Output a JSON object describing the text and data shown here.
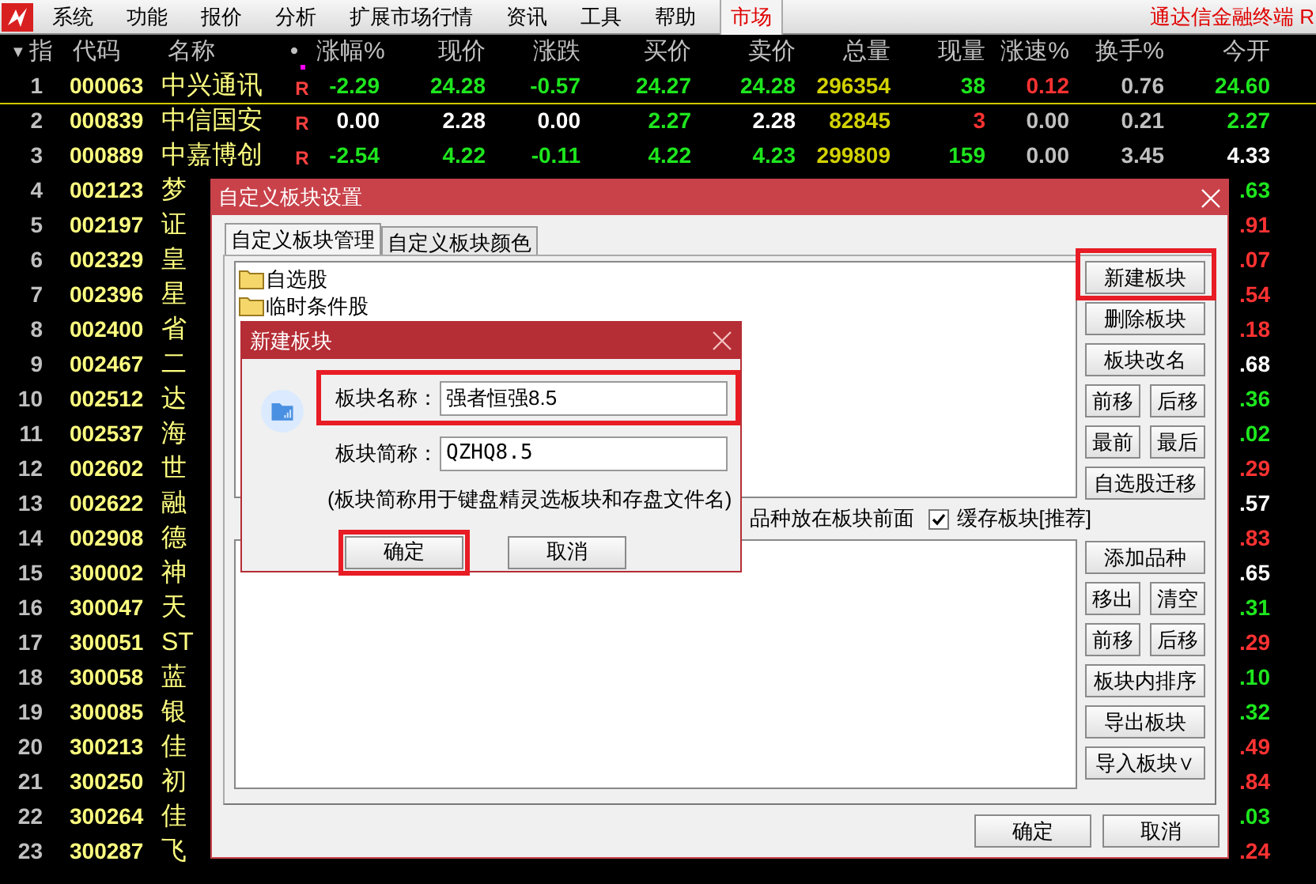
{
  "menu_bar": {
    "items": [
      "系统",
      "功能",
      "报价",
      "分析",
      "扩展市场行情",
      "资讯",
      "工具",
      "帮助"
    ],
    "tab": {
      "label": "市场",
      "selected": true
    },
    "brand": "通达信金融终端 R"
  },
  "table": {
    "sort_glyph": "▼",
    "lead_columns": [
      "指",
      "代码",
      "名称",
      "•"
    ],
    "columns": [
      "涨幅%",
      "现价",
      "涨跌",
      "买价",
      "卖价",
      "总量",
      "现量",
      "涨速%",
      "换手%",
      "今开"
    ],
    "rows": [
      {
        "kind": "full",
        "index": "1",
        "code": "000063",
        "name": "中兴通讯",
        "tag": "R",
        "flagged": true,
        "selected": true,
        "cells": [
          {
            "text": "-2.29",
            "color": "#1ee61e"
          },
          {
            "text": "24.28",
            "color": "#1ee61e"
          },
          {
            "text": "-0.57",
            "color": "#1ee61e"
          },
          {
            "text": "24.27",
            "color": "#1ee61e"
          },
          {
            "text": "24.28",
            "color": "#1ee61e"
          },
          {
            "text": "296354",
            "color": "#d2d200"
          },
          {
            "text": "38",
            "color": "#1ee61e"
          },
          {
            "text": "0.12",
            "color": "#ff3232"
          },
          {
            "text": "0.76",
            "color": "#c0c0c0"
          },
          {
            "text": "24.60",
            "color": "#1ee61e"
          }
        ]
      },
      {
        "kind": "full",
        "index": "2",
        "code": "000839",
        "name": "中信国安",
        "tag": "R",
        "flagged": false,
        "selected": false,
        "cells": [
          {
            "text": "0.00",
            "color": "#ffffff"
          },
          {
            "text": "2.28",
            "color": "#ffffff"
          },
          {
            "text": "0.00",
            "color": "#ffffff"
          },
          {
            "text": "2.27",
            "color": "#1ee61e"
          },
          {
            "text": "2.28",
            "color": "#ffffff"
          },
          {
            "text": "82845",
            "color": "#d2d200"
          },
          {
            "text": "3",
            "color": "#ff3232"
          },
          {
            "text": "0.00",
            "color": "#c0c0c0"
          },
          {
            "text": "0.21",
            "color": "#c0c0c0"
          },
          {
            "text": "2.27",
            "color": "#1ee61e"
          }
        ]
      },
      {
        "kind": "full",
        "index": "3",
        "code": "000889",
        "name": "中嘉博创",
        "tag": "R",
        "flagged": false,
        "selected": false,
        "cells": [
          {
            "text": "-2.54",
            "color": "#1ee61e"
          },
          {
            "text": "4.22",
            "color": "#1ee61e"
          },
          {
            "text": "-0.11",
            "color": "#1ee61e"
          },
          {
            "text": "4.22",
            "color": "#1ee61e"
          },
          {
            "text": "4.23",
            "color": "#1ee61e"
          },
          {
            "text": "299809",
            "color": "#d2d200"
          },
          {
            "text": "159",
            "color": "#1ee61e"
          },
          {
            "text": "0.00",
            "color": "#c0c0c0"
          },
          {
            "text": "3.45",
            "color": "#c0c0c0"
          },
          {
            "text": "4.33",
            "color": "#ffffff"
          }
        ]
      },
      {
        "kind": "covered",
        "index": "4",
        "code": "002123",
        "name": "梦",
        "selected": false,
        "cells": [
          {
            "text": ".63",
            "color": "#1ee61e"
          }
        ]
      },
      {
        "kind": "covered",
        "index": "5",
        "code": "002197",
        "name": "证",
        "selected": false,
        "cells": [
          {
            "text": ".91",
            "color": "#ff3232"
          }
        ]
      },
      {
        "kind": "covered",
        "index": "6",
        "code": "002329",
        "name": "皇",
        "selected": false,
        "cells": [
          {
            "text": ".07",
            "color": "#ff3232"
          }
        ]
      },
      {
        "kind": "covered",
        "index": "7",
        "code": "002396",
        "name": "星",
        "selected": false,
        "cells": [
          {
            "text": ".54",
            "color": "#ff3232"
          }
        ]
      },
      {
        "kind": "covered",
        "index": "8",
        "code": "002400",
        "name": "省",
        "selected": false,
        "cells": [
          {
            "text": ".18",
            "color": "#ff3232"
          }
        ]
      },
      {
        "kind": "covered",
        "index": "9",
        "code": "002467",
        "name": "二",
        "selected": false,
        "cells": [
          {
            "text": ".68",
            "color": "#ffffff"
          }
        ]
      },
      {
        "kind": "covered",
        "index": "10",
        "code": "002512",
        "name": "达",
        "selected": false,
        "cells": [
          {
            "text": ".36",
            "color": "#1ee61e"
          }
        ]
      },
      {
        "kind": "covered",
        "index": "11",
        "code": "002537",
        "name": "海",
        "selected": false,
        "cells": [
          {
            "text": ".02",
            "color": "#1ee61e"
          }
        ]
      },
      {
        "kind": "covered",
        "index": "12",
        "code": "002602",
        "name": "世",
        "selected": false,
        "cells": [
          {
            "text": ".29",
            "color": "#ff3232"
          }
        ]
      },
      {
        "kind": "covered",
        "index": "13",
        "code": "002622",
        "name": "融",
        "selected": false,
        "cells": [
          {
            "text": ".57",
            "color": "#ffffff"
          }
        ]
      },
      {
        "kind": "covered",
        "index": "14",
        "code": "002908",
        "name": "德",
        "selected": false,
        "cells": [
          {
            "text": ".83",
            "color": "#ff3232"
          }
        ]
      },
      {
        "kind": "covered",
        "index": "15",
        "code": "300002",
        "name": "神",
        "selected": false,
        "cells": [
          {
            "text": ".65",
            "color": "#ffffff"
          }
        ]
      },
      {
        "kind": "covered",
        "index": "16",
        "code": "300047",
        "name": "天",
        "selected": false,
        "cells": [
          {
            "text": ".31",
            "color": "#1ee61e"
          }
        ]
      },
      {
        "kind": "covered",
        "index": "17",
        "code": "300051",
        "name": "ST",
        "selected": false,
        "cells": [
          {
            "text": ".29",
            "color": "#ff3232"
          }
        ]
      },
      {
        "kind": "covered",
        "index": "18",
        "code": "300058",
        "name": "蓝",
        "selected": false,
        "cells": [
          {
            "text": ".10",
            "color": "#1ee61e"
          }
        ]
      },
      {
        "kind": "covered",
        "index": "19",
        "code": "300085",
        "name": "银",
        "selected": false,
        "cells": [
          {
            "text": ".32",
            "color": "#1ee61e"
          }
        ]
      },
      {
        "kind": "covered",
        "index": "20",
        "code": "300213",
        "name": "佳",
        "selected": false,
        "cells": [
          {
            "text": ".49",
            "color": "#ff3232"
          }
        ]
      },
      {
        "kind": "covered",
        "index": "21",
        "code": "300250",
        "name": "初",
        "selected": false,
        "cells": [
          {
            "text": ".84",
            "color": "#ff3232"
          }
        ]
      },
      {
        "kind": "covered",
        "index": "22",
        "code": "300264",
        "name": "佳",
        "selected": false,
        "cells": [
          {
            "text": ".03",
            "color": "#1ee61e"
          }
        ]
      },
      {
        "kind": "covered",
        "index": "23",
        "code": "300287",
        "name": "飞",
        "selected": false,
        "cells": [
          {
            "text": ".24",
            "color": "#ff3232"
          }
        ]
      }
    ]
  },
  "block_settings": {
    "title": "自定义板块设置",
    "tabs": [
      {
        "label": "自定义板块管理",
        "selected": true
      },
      {
        "label": "自定义板块颜色",
        "selected": false
      }
    ],
    "blocks": [
      {
        "label": "自选股"
      },
      {
        "label": "临时条件股"
      }
    ],
    "options": [
      {
        "kind": "text",
        "label": "品种放在板块前面"
      },
      {
        "kind": "checkbox",
        "label": "缓存板块[推荐]",
        "checked": true
      }
    ],
    "side_buttons": [
      [
        {
          "label": "新建板块",
          "highlighted": true
        }
      ],
      [
        {
          "label": "删除板块",
          "highlighted": false
        }
      ],
      [
        {
          "label": "板块改名",
          "highlighted": false
        }
      ],
      [
        {
          "label": "前移",
          "highlighted": false
        },
        {
          "label": "后移",
          "highlighted": false
        }
      ],
      [
        {
          "label": "最前",
          "highlighted": false
        },
        {
          "label": "最后",
          "highlighted": false
        }
      ],
      [
        {
          "label": "自选股迁移",
          "highlighted": false
        }
      ]
    ],
    "stock_buttons": [
      [
        "添加品种"
      ],
      [
        "移出",
        "清空"
      ],
      [
        "前移",
        "后移"
      ],
      [
        "板块内排序"
      ],
      [
        "导出板块"
      ],
      [
        "导入板块∨"
      ]
    ],
    "footer_buttons": [
      "确定",
      "取消"
    ]
  },
  "new_block": {
    "title": "新建板块",
    "fields": [
      {
        "label": "板块名称：",
        "value": "强者恒强8.5",
        "highlighted": true
      },
      {
        "label": "板块简称：",
        "value": "QZHQ8.5",
        "highlighted": false
      }
    ],
    "note": "(板块简称用于键盘精灵选板块和存盘文件名)",
    "buttons": [
      {
        "label": "确定",
        "highlighted": true
      },
      {
        "label": "取消",
        "highlighted": false
      }
    ]
  }
}
